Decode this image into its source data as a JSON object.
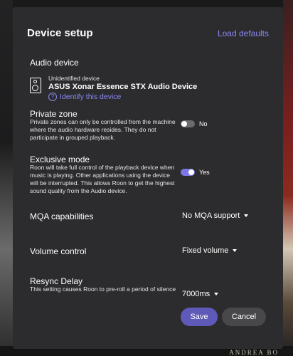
{
  "dialog": {
    "title": "Device setup",
    "load_defaults": "Load defaults"
  },
  "audio_device": {
    "label": "Audio device",
    "subtitle": "Unidentified device",
    "name": "ASUS Xonar Essence STX Audio Device",
    "identify_link": "Identify this device",
    "icon": "speaker-icon"
  },
  "private_zone": {
    "label": "Private zone",
    "description": "Private zones can only be controlled from the machine where the audio hardware resides. They do not participate in grouped playback.",
    "value": "No",
    "enabled": false
  },
  "exclusive_mode": {
    "label": "Exclusive mode",
    "description": "Roon will take full control of the playback device when music is playing. Other applications using the device will be interrupted. This allows Roon to get the highest sound quality from the Audio device.",
    "value": "Yes",
    "enabled": true
  },
  "mqa": {
    "label": "MQA capabilities",
    "value": "No MQA support"
  },
  "volume": {
    "label": "Volume control",
    "value": "Fixed volume"
  },
  "resync": {
    "label": "Resync Delay",
    "description": "This setting causes Roon to pre-roll a period of silence",
    "value": "7000ms"
  },
  "buttons": {
    "save": "Save",
    "cancel": "Cancel"
  },
  "background": {
    "caption": "ANDREA BO"
  },
  "colors": {
    "accent": "#8a87f0",
    "save_button": "#5f5ab8",
    "dialog_bg": "#2c2c2e"
  }
}
